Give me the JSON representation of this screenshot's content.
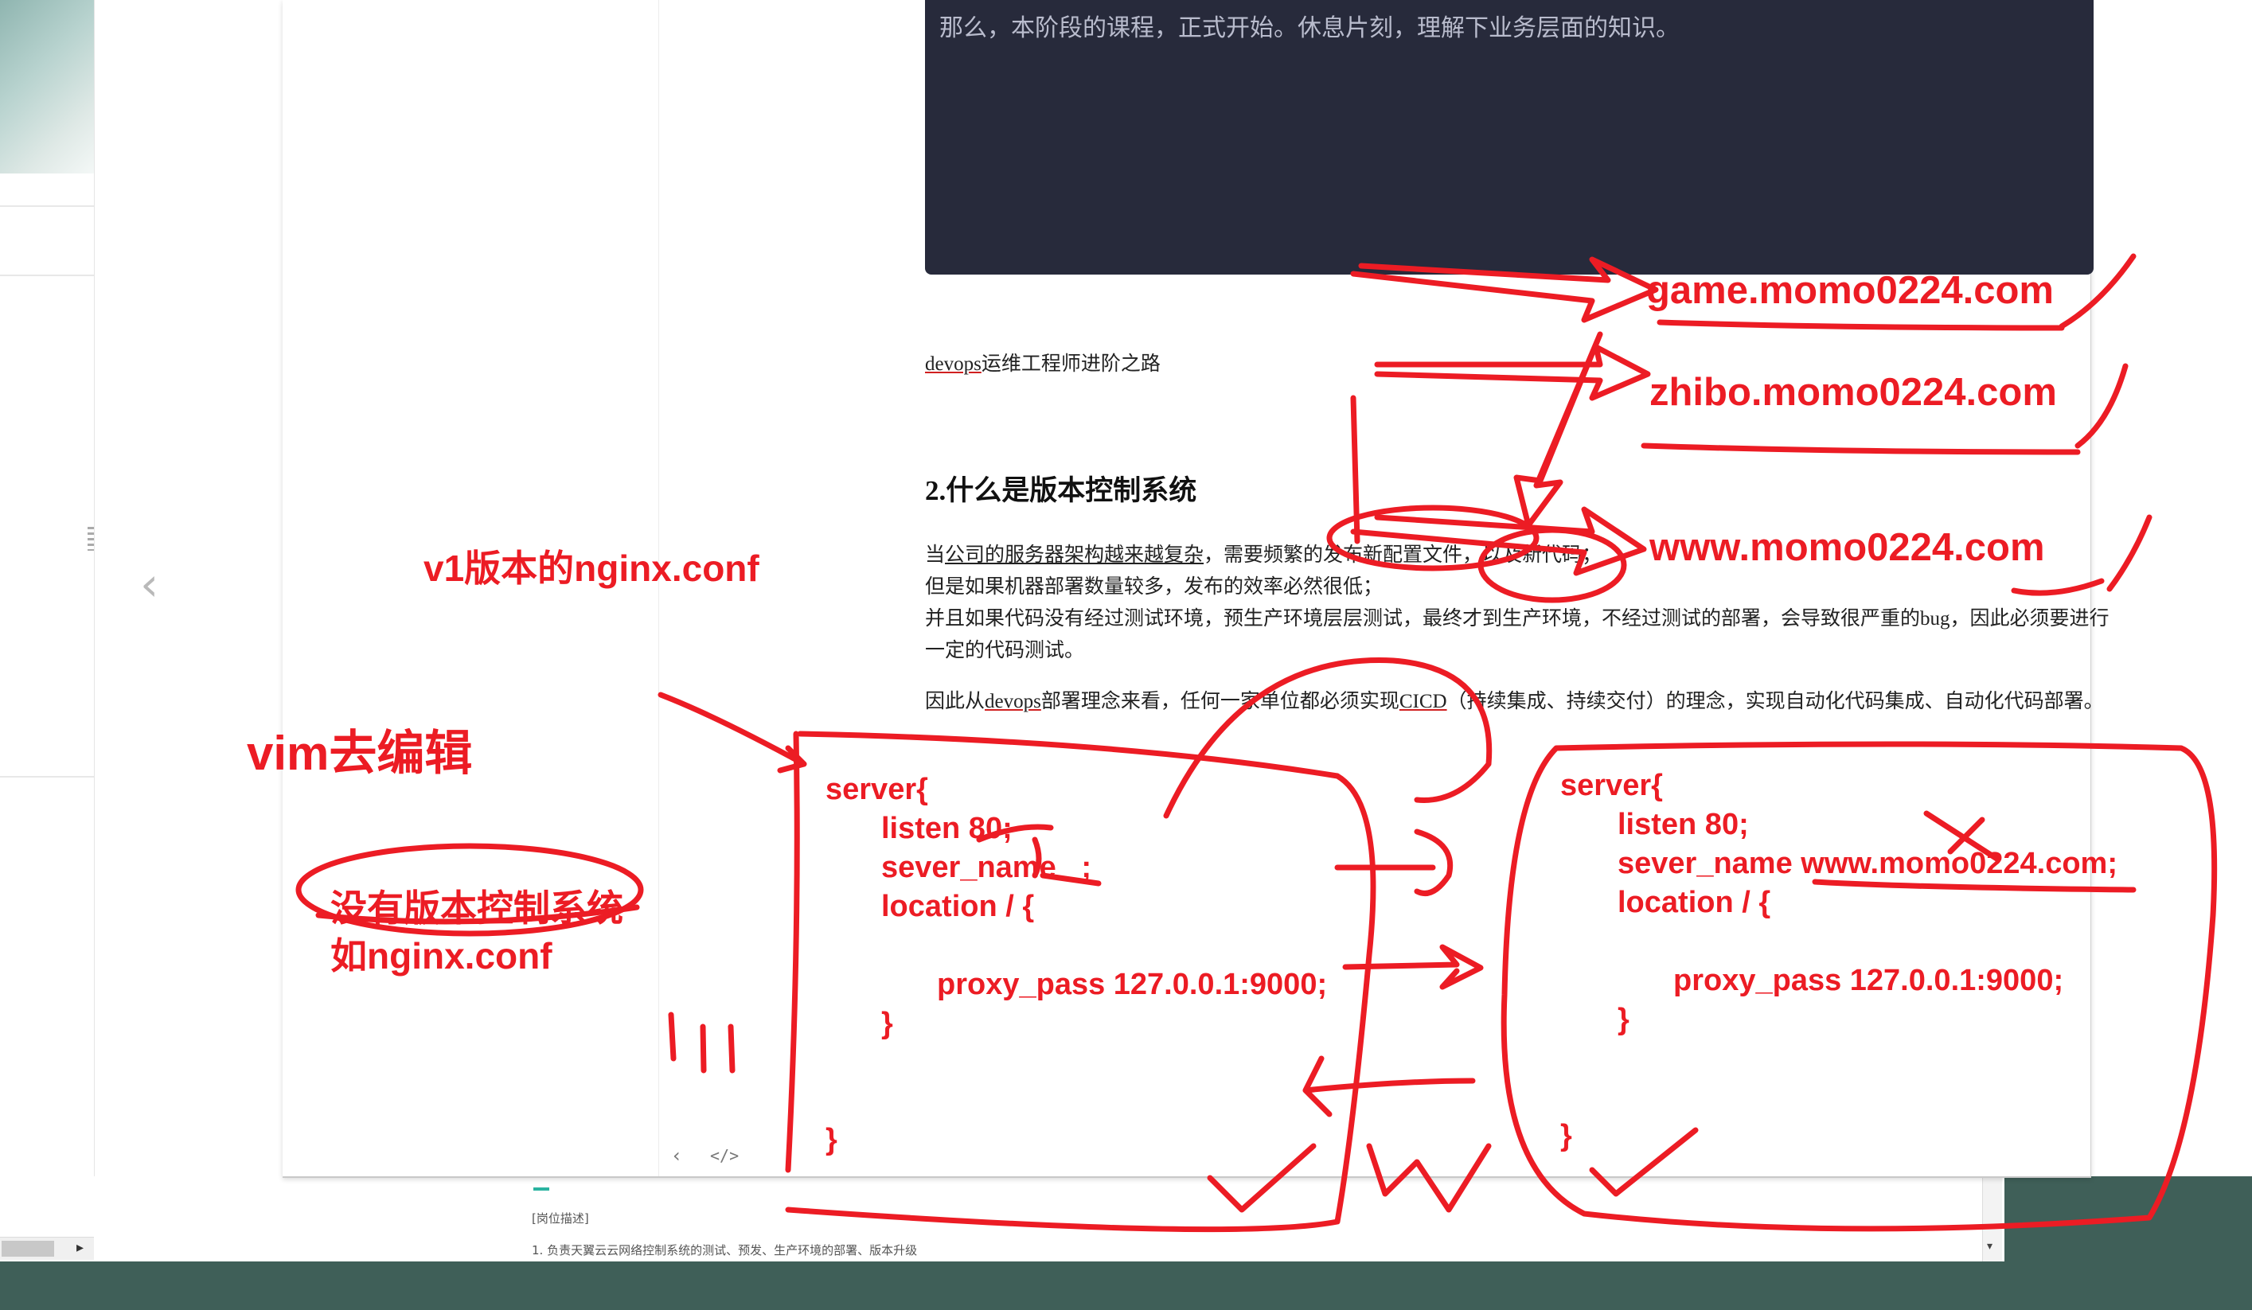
{
  "colors": {
    "annotation_red": "#ec1c24",
    "quote_bg": "#272a3b",
    "desktop_green": "#3f5f58",
    "accent_teal": "#2ab3a0"
  },
  "quote_block": {
    "text": "那么，本阶段的课程，正式开始。休息片刻，理解下业务层面的知识。"
  },
  "document": {
    "devops_line": {
      "word": "devops",
      "rest": "运维工程师进阶之路"
    },
    "heading": "2.什么是版本控制系统",
    "p1": {
      "seg1": "当",
      "seg2": "公司的服务器架构越来越复杂",
      "seg3": "，需要频繁的发布新配置文件，以及新代码；"
    },
    "p2": "但是如果机器部署数量较多，发布的效率必然很低；",
    "p3_line1": "并且如果代码没有经过测试环境，预生产环境层层测试，最终才到生产环境，不经过测试的部署，会导致很严重的bug，因此必须要进行",
    "p3_line2": "一定的代码测试。",
    "p4": {
      "seg1": "因此从",
      "seg2": "devops",
      "seg3": "部署理念来看，任何一家单位都必须实现",
      "seg4": "CICD",
      "seg5": "（持续集成、持续交付）的理念，实现自动化代码集成、自动化代码部署。"
    }
  },
  "bottom_page": {
    "label": "[岗位描述]",
    "item1": "1. 负责天翼云云网络控制系统的测试、预发、生产环境的部署、版本升级"
  },
  "sidebar_icons": [
    "chevron-left-icon",
    "code-icon"
  ],
  "annotations": {
    "domains": [
      "game.momo0224.com",
      "zhibo.momo0224.com",
      "www.momo0224.com"
    ],
    "v1_label": "v1版本的nginx.conf",
    "vim_label": "vim去编辑",
    "no_vcs_label": "没有版本控制系统",
    "example_label": "如nginx.conf",
    "conf_left": {
      "l1": "server{",
      "l2": "listen 80;",
      "l3": "sever_name  _;",
      "l4": "location / {",
      "l5": "proxy_pass 127.0.0.1:9000;",
      "l6": "}",
      "l7": "}"
    },
    "conf_right": {
      "l1": "server{",
      "l2": "listen 80;",
      "l3": "sever_name  www.momo0224.com;",
      "l4": "location / {",
      "l5": "proxy_pass 127.0.0.1:9000;",
      "l6": "}",
      "l7": "}"
    }
  }
}
